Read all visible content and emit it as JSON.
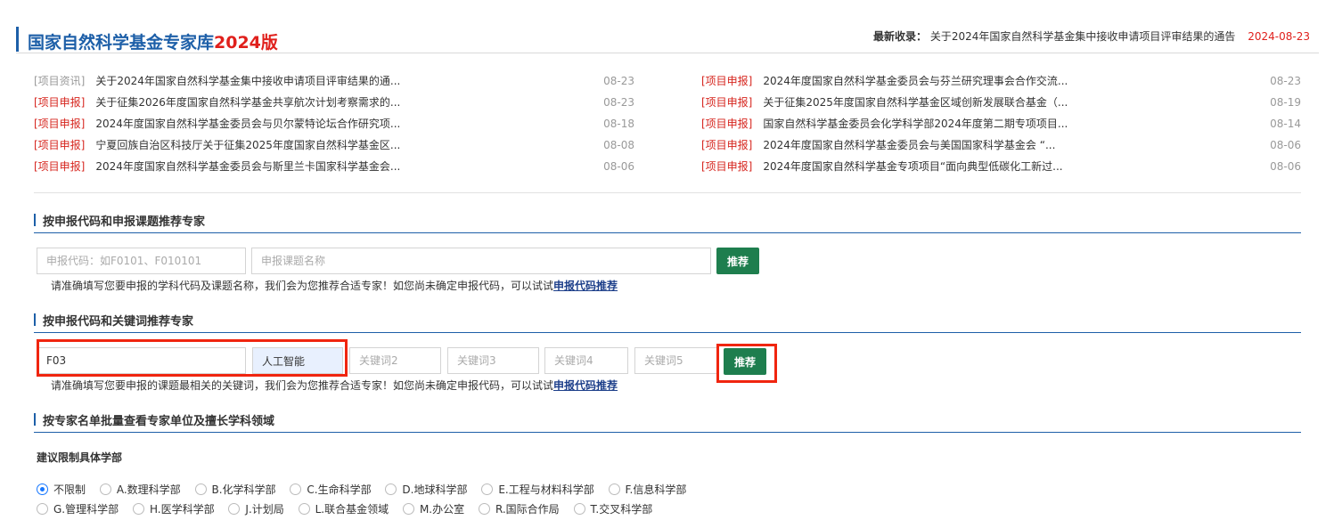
{
  "header": {
    "title": "国家自然科学基金专家库",
    "title_year": "2024版",
    "latest_label": "最新收录：",
    "latest_text": "关于2024年国家自然科学基金集中接收申请项目评审结果的通告",
    "latest_date": "2024-08-23"
  },
  "news_left": [
    {
      "category": "[项目资讯]",
      "title": "关于2024年国家自然科学基金集中接收申请项目评审结果的通...",
      "date": "08-23"
    },
    {
      "category": "[项目申报]",
      "title": "关于征集2026年度国家自然科学基金共享航次计划考察需求的...",
      "date": "08-23"
    },
    {
      "category": "[项目申报]",
      "title": "2024年度国家自然科学基金委员会与贝尔蒙特论坛合作研究项...",
      "date": "08-18"
    },
    {
      "category": "[项目申报]",
      "title": "宁夏回族自治区科技厅关于征集2025年度国家自然科学基金区...",
      "date": "08-08"
    },
    {
      "category": "[项目申报]",
      "title": "2024年度国家自然科学基金委员会与斯里兰卡国家科学基金会...",
      "date": "08-06"
    }
  ],
  "news_right": [
    {
      "category": "[项目申报]",
      "title": "2024年度国家自然科学基金委员会与芬兰研究理事会合作交流...",
      "date": "08-23"
    },
    {
      "category": "[项目申报]",
      "title": "关于征集2025年度国家自然科学基金区域创新发展联合基金（...",
      "date": "08-19"
    },
    {
      "category": "[项目申报]",
      "title": "国家自然科学基金委员会化学科学部2024年度第二期专项项目...",
      "date": "08-14"
    },
    {
      "category": "[项目申报]",
      "title": "2024年度国家自然科学基金委员会与美国国家科学基金会 “...",
      "date": "08-06"
    },
    {
      "category": "[项目申报]",
      "title": "2024年度国家自然科学基金专项项目“面向典型低碳化工新过...",
      "date": "08-06"
    }
  ],
  "section1": {
    "title": "按申报代码和申报课题推荐专家",
    "code_placeholder": "申报代码：如F0101、F010101",
    "topic_placeholder": "申报课题名称",
    "button": "推荐",
    "hint": "请准确填写您要申报的学科代码及课题名称，我们会为您推荐合适专家！如您尚未确定申报代码，可以试试",
    "hint_link": "申报代码推荐"
  },
  "section2": {
    "title": "按申报代码和关键词推荐专家",
    "code_value": "F03",
    "keyword1_value": "人工智能",
    "keyword2_placeholder": "关键词2",
    "keyword3_placeholder": "关键词3",
    "keyword4_placeholder": "关键词4",
    "keyword5_placeholder": "关键词5",
    "button": "推荐",
    "hint": "请准确填写您要申报的课题最相关的关键词，我们会为您推荐合适专家！如您尚未确定申报代码，可以试试",
    "hint_link": "申报代码推荐"
  },
  "section3": {
    "title": "按专家名单批量查看专家单位及擅长学科领域",
    "sub_label": "建议限制具体学部",
    "options_row1": [
      "不限制",
      "A.数理科学部",
      "B.化学科学部",
      "C.生命科学部",
      "D.地球科学部",
      "E.工程与材料科学部",
      "F.信息科学部"
    ],
    "options_row2": [
      "G.管理科学部",
      "H.医学科学部",
      "J.计划局",
      "L.联合基金领域",
      "M.办公室",
      "R.国际合作局",
      "T.交叉科学部"
    ],
    "selected": "不限制"
  },
  "colors": {
    "brand_blue": "#1d5fa8",
    "accent_red": "#e0201c",
    "button_green": "#1e7e4e",
    "highlight_red": "#f0250f"
  }
}
